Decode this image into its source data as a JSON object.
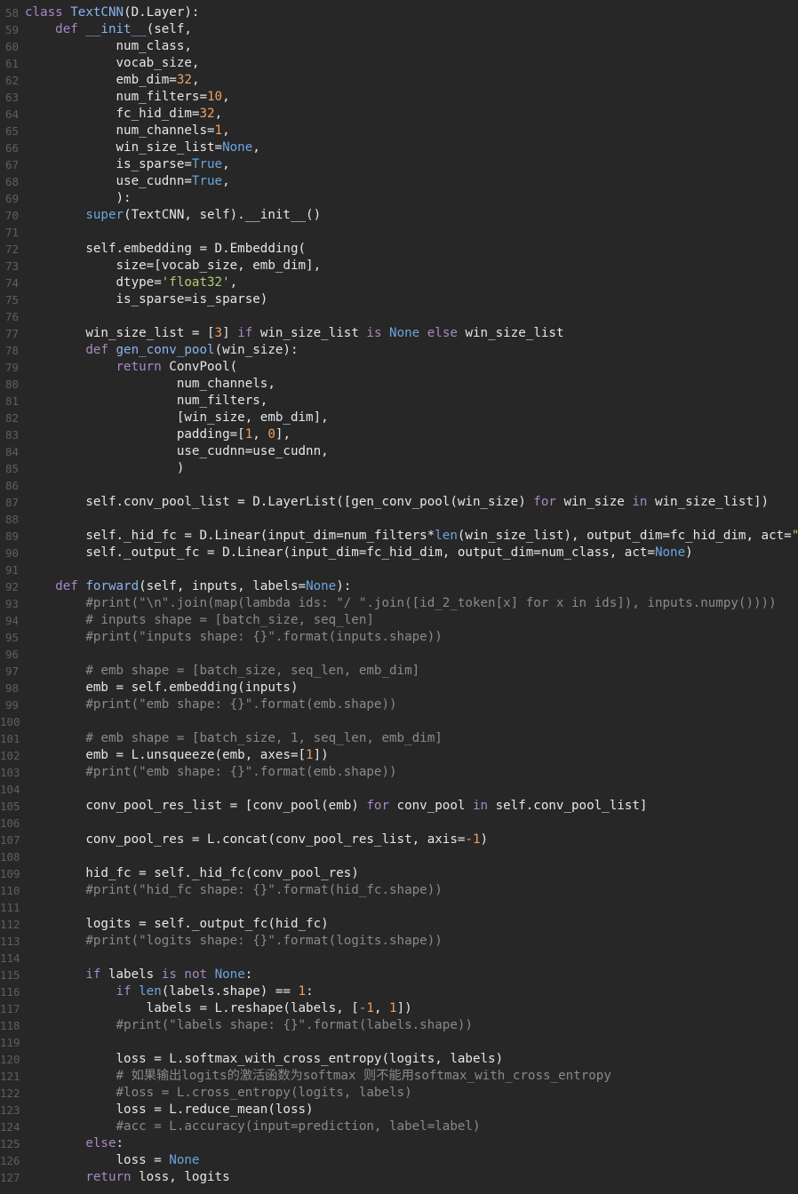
{
  "editor": {
    "language": "python",
    "theme_colors": {
      "background": "#272727",
      "keyword": "#a788c7",
      "builtin": "#6aa6e0",
      "number": "#f0a060",
      "string": "#b3cd72",
      "comment": "#8a8a8a",
      "line_number": "#5f5f5f"
    },
    "lines": [
      {
        "n": "58",
        "html": "<span class=\"kw\">class</span> <span class=\"fn\">TextCNN</span>(D.Layer):"
      },
      {
        "n": "59",
        "html": "    <span class=\"kw\">def</span> <span class=\"fn\">__init__</span>(self,"
      },
      {
        "n": "60",
        "html": "            num_class,"
      },
      {
        "n": "61",
        "html": "            vocab_size,"
      },
      {
        "n": "62",
        "html": "            emb_dim=<span class=\"num\">32</span>,"
      },
      {
        "n": "63",
        "html": "            num_filters=<span class=\"num\">10</span>,"
      },
      {
        "n": "64",
        "html": "            fc_hid_dim=<span class=\"num\">32</span>,"
      },
      {
        "n": "65",
        "html": "            num_channels=<span class=\"num\">1</span>,"
      },
      {
        "n": "66",
        "html": "            win_size_list=<span class=\"bi\">None</span>,"
      },
      {
        "n": "67",
        "html": "            is_sparse=<span class=\"bi\">True</span>,"
      },
      {
        "n": "68",
        "html": "            use_cudnn=<span class=\"bi\">True</span>,"
      },
      {
        "n": "69",
        "html": "            ):"
      },
      {
        "n": "70",
        "html": "        <span class=\"bi\">super</span>(TextCNN, self).__init__()"
      },
      {
        "n": "71",
        "html": ""
      },
      {
        "n": "72",
        "html": "        self.embedding = D.Embedding("
      },
      {
        "n": "73",
        "html": "            size=[vocab_size, emb_dim],"
      },
      {
        "n": "74",
        "html": "            dtype=<span class=\"str\">'float32'</span>,"
      },
      {
        "n": "75",
        "html": "            is_sparse=is_sparse)"
      },
      {
        "n": "76",
        "html": ""
      },
      {
        "n": "77",
        "html": "        win_size_list = [<span class=\"num\">3</span>] <span class=\"kw\">if</span> win_size_list <span class=\"kw\">is</span> <span class=\"bi\">None</span> <span class=\"kw\">else</span> win_size_list"
      },
      {
        "n": "78",
        "html": "        <span class=\"kw\">def</span> <span class=\"fn\">gen_conv_pool</span>(win_size):"
      },
      {
        "n": "79",
        "html": "            <span class=\"kw\">return</span> ConvPool("
      },
      {
        "n": "80",
        "html": "                    num_channels,"
      },
      {
        "n": "81",
        "html": "                    num_filters,"
      },
      {
        "n": "82",
        "html": "                    [win_size, emb_dim],"
      },
      {
        "n": "83",
        "html": "                    padding=[<span class=\"num\">1</span>, <span class=\"num\">0</span>],"
      },
      {
        "n": "84",
        "html": "                    use_cudnn=use_cudnn,"
      },
      {
        "n": "85",
        "html": "                    )"
      },
      {
        "n": "86",
        "html": ""
      },
      {
        "n": "87",
        "html": "        self.conv_pool_list = D.LayerList([gen_conv_pool(win_size) <span class=\"kw\">for</span> win_size <span class=\"kw\">in</span> win_size_list])"
      },
      {
        "n": "88",
        "html": ""
      },
      {
        "n": "89",
        "html": "        self._hid_fc = D.Linear(input_dim=num_filters*<span class=\"bi\">len</span>(win_size_list), output_dim=fc_hid_dim, act=<span class=\"str\">\"tanh\"</span>)"
      },
      {
        "n": "90",
        "html": "        self._output_fc = D.Linear(input_dim=fc_hid_dim, output_dim=num_class, act=<span class=\"bi\">None</span>)"
      },
      {
        "n": "91",
        "html": ""
      },
      {
        "n": "92",
        "html": "    <span class=\"kw\">def</span> <span class=\"fn\">forward</span>(self, inputs, labels=<span class=\"bi\">None</span>):"
      },
      {
        "n": "93",
        "html": "        <span class=\"cm\">#print(\"\\n\".join(map(lambda ids: \"/ \".join([id_2_token[x] for x in ids]), inputs.numpy())))</span>"
      },
      {
        "n": "94",
        "html": "        <span class=\"cm\"># inputs shape = [batch_size, seq_len]</span>"
      },
      {
        "n": "95",
        "html": "        <span class=\"cm\">#print(\"inputs shape: {}\".format(inputs.shape))</span>"
      },
      {
        "n": "96",
        "html": ""
      },
      {
        "n": "97",
        "html": "        <span class=\"cm\"># emb shape = [batch_size, seq_len, emb_dim]</span>"
      },
      {
        "n": "98",
        "html": "        emb = self.embedding(inputs)"
      },
      {
        "n": "99",
        "html": "        <span class=\"cm\">#print(\"emb shape: {}\".format(emb.shape))</span>"
      },
      {
        "n": "100",
        "html": ""
      },
      {
        "n": "101",
        "html": "        <span class=\"cm\"># emb shape = [batch_size, 1, seq_len, emb_dim]</span>"
      },
      {
        "n": "102",
        "html": "        emb = L.unsqueeze(emb, axes=[<span class=\"num\">1</span>])"
      },
      {
        "n": "103",
        "html": "        <span class=\"cm\">#print(\"emb shape: {}\".format(emb.shape))</span>"
      },
      {
        "n": "104",
        "html": ""
      },
      {
        "n": "105",
        "html": "        conv_pool_res_list = [conv_pool(emb) <span class=\"kw\">for</span> conv_pool <span class=\"kw\">in</span> self.conv_pool_list]"
      },
      {
        "n": "106",
        "html": ""
      },
      {
        "n": "107",
        "html": "        conv_pool_res = L.concat(conv_pool_res_list, axis=<span class=\"num\">-1</span>)"
      },
      {
        "n": "108",
        "html": ""
      },
      {
        "n": "109",
        "html": "        hid_fc = self._hid_fc(conv_pool_res)"
      },
      {
        "n": "110",
        "html": "        <span class=\"cm\">#print(\"hid_fc shape: {}\".format(hid_fc.shape))</span>"
      },
      {
        "n": "111",
        "html": ""
      },
      {
        "n": "112",
        "html": "        logits = self._output_fc(hid_fc)"
      },
      {
        "n": "113",
        "html": "        <span class=\"cm\">#print(\"logits shape: {}\".format(logits.shape))</span>"
      },
      {
        "n": "114",
        "html": ""
      },
      {
        "n": "115",
        "html": "        <span class=\"kw\">if</span> labels <span class=\"kw\">is</span> <span class=\"kw\">not</span> <span class=\"bi\">None</span>:"
      },
      {
        "n": "116",
        "html": "            <span class=\"kw\">if</span> <span class=\"bi\">len</span>(labels.shape) == <span class=\"num\">1</span>:"
      },
      {
        "n": "117",
        "html": "                labels = L.reshape(labels, [<span class=\"num\">-1</span>, <span class=\"num\">1</span>])"
      },
      {
        "n": "118",
        "html": "            <span class=\"cm\">#print(\"labels shape: {}\".format(labels.shape))</span>"
      },
      {
        "n": "119",
        "html": ""
      },
      {
        "n": "120",
        "html": "            loss = L.softmax_with_cross_entropy(logits, labels)"
      },
      {
        "n": "121",
        "html": "            <span class=\"cm\"># 如果输出logits的激活函数为softmax 则不能用softmax_with_cross_entropy</span>"
      },
      {
        "n": "122",
        "html": "            <span class=\"cm\">#loss = L.cross_entropy(logits, labels)</span>"
      },
      {
        "n": "123",
        "html": "            loss = L.reduce_mean(loss)"
      },
      {
        "n": "124",
        "html": "            <span class=\"cm\">#acc = L.accuracy(input=prediction, label=label)</span>"
      },
      {
        "n": "125",
        "html": "        <span class=\"kw\">else</span>:"
      },
      {
        "n": "126",
        "html": "            loss = <span class=\"bi\">None</span>"
      },
      {
        "n": "127",
        "html": "        <span class=\"kw\">return</span> loss, logits"
      }
    ]
  }
}
